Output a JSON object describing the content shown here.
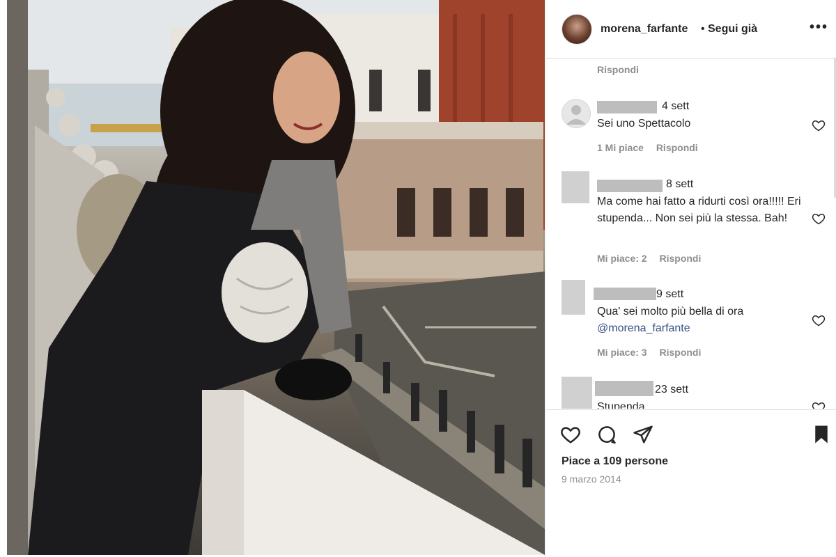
{
  "post": {
    "username": "morena_farfante",
    "separator": "•",
    "follow_label": "Segui già",
    "more_label": "•••"
  },
  "comments": {
    "top_reply_label": "Rispondi",
    "items": [
      {
        "time": "4 sett",
        "text": "Sei uno Spettacolo",
        "likes_label": "1 Mi piace",
        "reply_label": "Rispondi"
      },
      {
        "time": "8 sett",
        "text": "Ma come hai fatto a ridurti così ora!!!!! Eri stupenda... Non sei più la stessa. Bah!",
        "likes_label": "Mi piace: 2",
        "reply_label": "Rispondi"
      },
      {
        "time": "9 sett",
        "text": "Qua' sei molto più bella di ora",
        "mention": "@morena_farfante",
        "likes_label": "Mi piace: 3",
        "reply_label": "Rispondi"
      },
      {
        "time": "23 sett",
        "text": "Stupenda"
      }
    ]
  },
  "footer": {
    "likes_text": "Piace a 109 persone",
    "date_text": "9 marzo 2014"
  },
  "icons": {
    "like": "heart-icon",
    "comment": "comment-icon",
    "share": "send-icon",
    "save": "bookmark-icon"
  },
  "colors": {
    "text": "#262626",
    "secondary": "#8e8e8e",
    "mention": "#385185"
  }
}
